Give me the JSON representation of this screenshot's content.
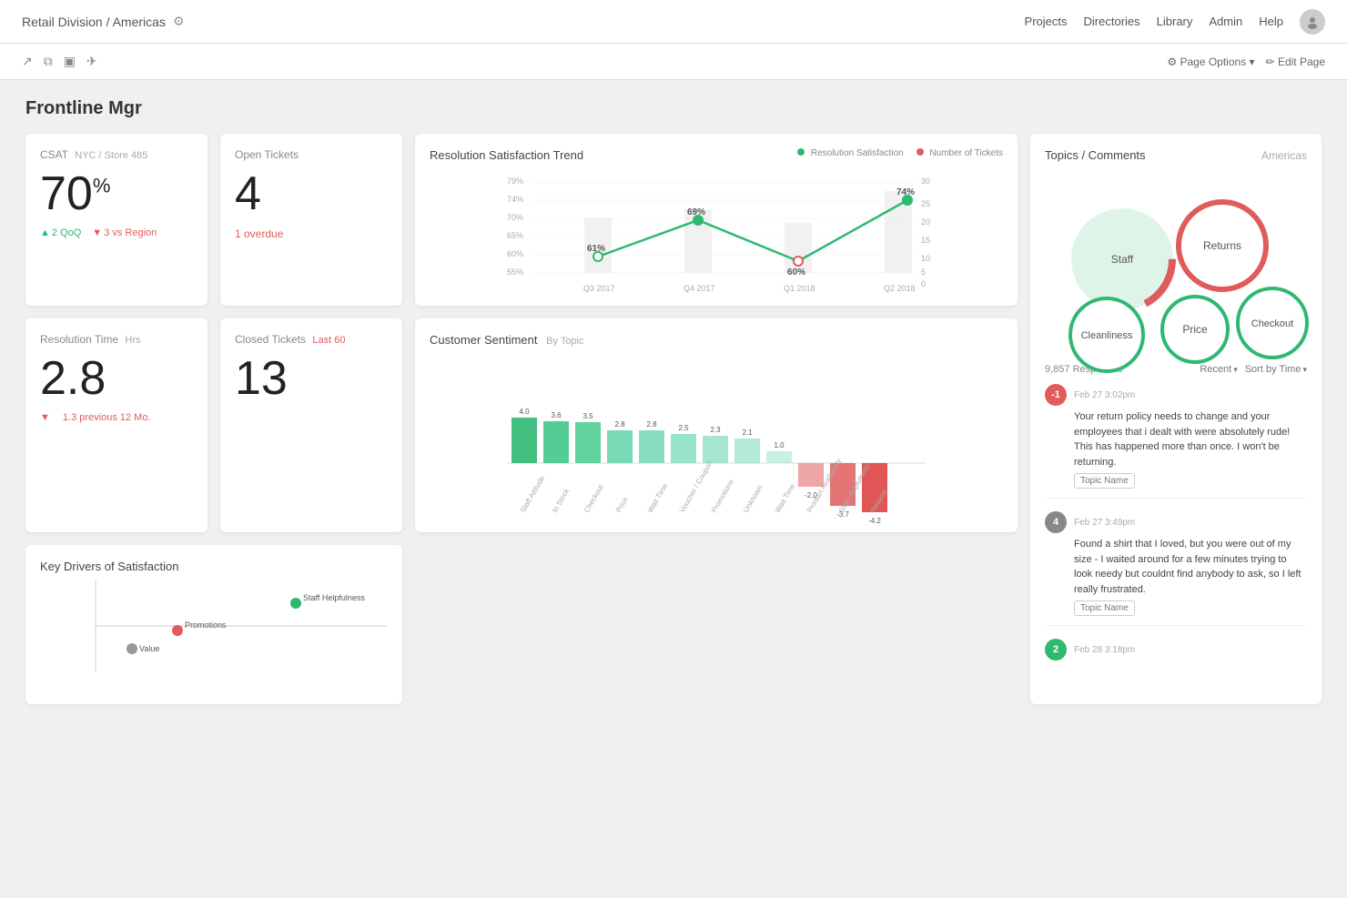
{
  "nav": {
    "breadcrumb": "Retail Division / Americas",
    "links": [
      "Projects",
      "Directories",
      "Library",
      "Admin",
      "Help"
    ],
    "page_options": "Page Options",
    "edit_page": "Edit Page"
  },
  "page": {
    "title": "Frontline Mgr"
  },
  "csat": {
    "title": "CSAT",
    "subtitle": "NYC / Store 485",
    "value": "70",
    "unit": "%",
    "qoq_label": "2 QoQ",
    "region_label": "3 vs Region"
  },
  "open_tickets": {
    "title": "Open Tickets",
    "value": "4",
    "overdue": "1 overdue"
  },
  "resolution_trend": {
    "title": "Resolution Satisfaction Trend",
    "legend_satisfaction": "Resolution Satisfaction",
    "legend_tickets": "Number of Tickets",
    "points": [
      {
        "label": "Q3 2017",
        "value": 61,
        "x": 0
      },
      {
        "label": "Q4 2017",
        "value": 69,
        "x": 1
      },
      {
        "label": "Q1 2018",
        "value": 60,
        "x": 2
      },
      {
        "label": "Q2 2018",
        "value": 74,
        "x": 3
      }
    ],
    "y_labels": [
      "79%",
      "74%",
      "70%",
      "65%",
      "60%",
      "55%"
    ]
  },
  "resolution_time": {
    "title": "Resolution Time",
    "subtitle": "Hrs",
    "value": "2.8",
    "change_label": "1.3 previous 12 Mo."
  },
  "closed_tickets": {
    "title": "Closed Tickets",
    "subtitle": "Last 60",
    "value": "13"
  },
  "sentiment": {
    "title": "Customer Sentiment",
    "subtitle": "By Topic",
    "bars": [
      {
        "label": "Staff Attitude",
        "value": 4.0,
        "positive": true
      },
      {
        "label": "In Stock",
        "value": 3.6,
        "positive": true
      },
      {
        "label": "Checkout",
        "value": 3.5,
        "positive": true
      },
      {
        "label": "Price",
        "value": 2.8,
        "positive": true
      },
      {
        "label": "Wait Time",
        "value": 2.8,
        "positive": true
      },
      {
        "label": "Voucher / Coupon",
        "value": 2.5,
        "positive": true
      },
      {
        "label": "Promotions",
        "value": 2.3,
        "positive": true
      },
      {
        "label": "Unknown",
        "value": 2.1,
        "positive": true
      },
      {
        "label": "Wait Time",
        "value": 1.0,
        "positive": true
      },
      {
        "label": "Product Availability",
        "value": -2.0,
        "positive": false
      },
      {
        "label": "Staff Helpfulness",
        "value": -3.7,
        "positive": false
      },
      {
        "label": "Returns",
        "value": -4.2,
        "positive": false
      }
    ]
  },
  "topics": {
    "title": "Topics / Comments",
    "subtitle": "Americas",
    "bubbles": [
      {
        "label": "Staff",
        "color": "#2eb872",
        "border": "#e05c5c",
        "size": 80
      },
      {
        "label": "Returns",
        "color": "#fff",
        "border": "#e05c5c",
        "size": 72
      },
      {
        "label": "Cleanliness",
        "color": "#fff",
        "border": "#2eb872",
        "size": 62
      },
      {
        "label": "Price",
        "color": "#fff",
        "border": "#2eb872",
        "size": 60
      },
      {
        "label": "Checkout",
        "color": "#fff",
        "border": "#2eb872",
        "size": 58
      }
    ],
    "response_count": "9,857 Responses",
    "filter_recent": "Recent",
    "filter_sort": "Sort by Time",
    "comments": [
      {
        "score": "-1",
        "sentiment": "negative",
        "date": "Feb 27  3:02pm",
        "text": "Your return policy needs to change and your employees that i dealt with were absolutely rude! This has happened more than once.  I won't be returning.",
        "tag": "Topic Name"
      },
      {
        "score": "4",
        "sentiment": "neutral",
        "date": "Feb 27  3:49pm",
        "text": "Found a shirt that I loved, but you were out of my size - I waited around for a few minutes trying to look needy but couldnt find anybody to ask, so I left really frustrated.",
        "tag": "Topic Name"
      }
    ]
  },
  "key_drivers": {
    "title": "Key Drivers of Satisfaction",
    "points": [
      {
        "label": "Staff Helpfulness",
        "x": 72,
        "y": 30,
        "color": "#2eb872"
      },
      {
        "label": "Promotions",
        "x": 28,
        "y": 55,
        "color": "#e05c5c"
      },
      {
        "label": "Value",
        "x": 20,
        "y": 72,
        "color": "#999"
      }
    ]
  }
}
